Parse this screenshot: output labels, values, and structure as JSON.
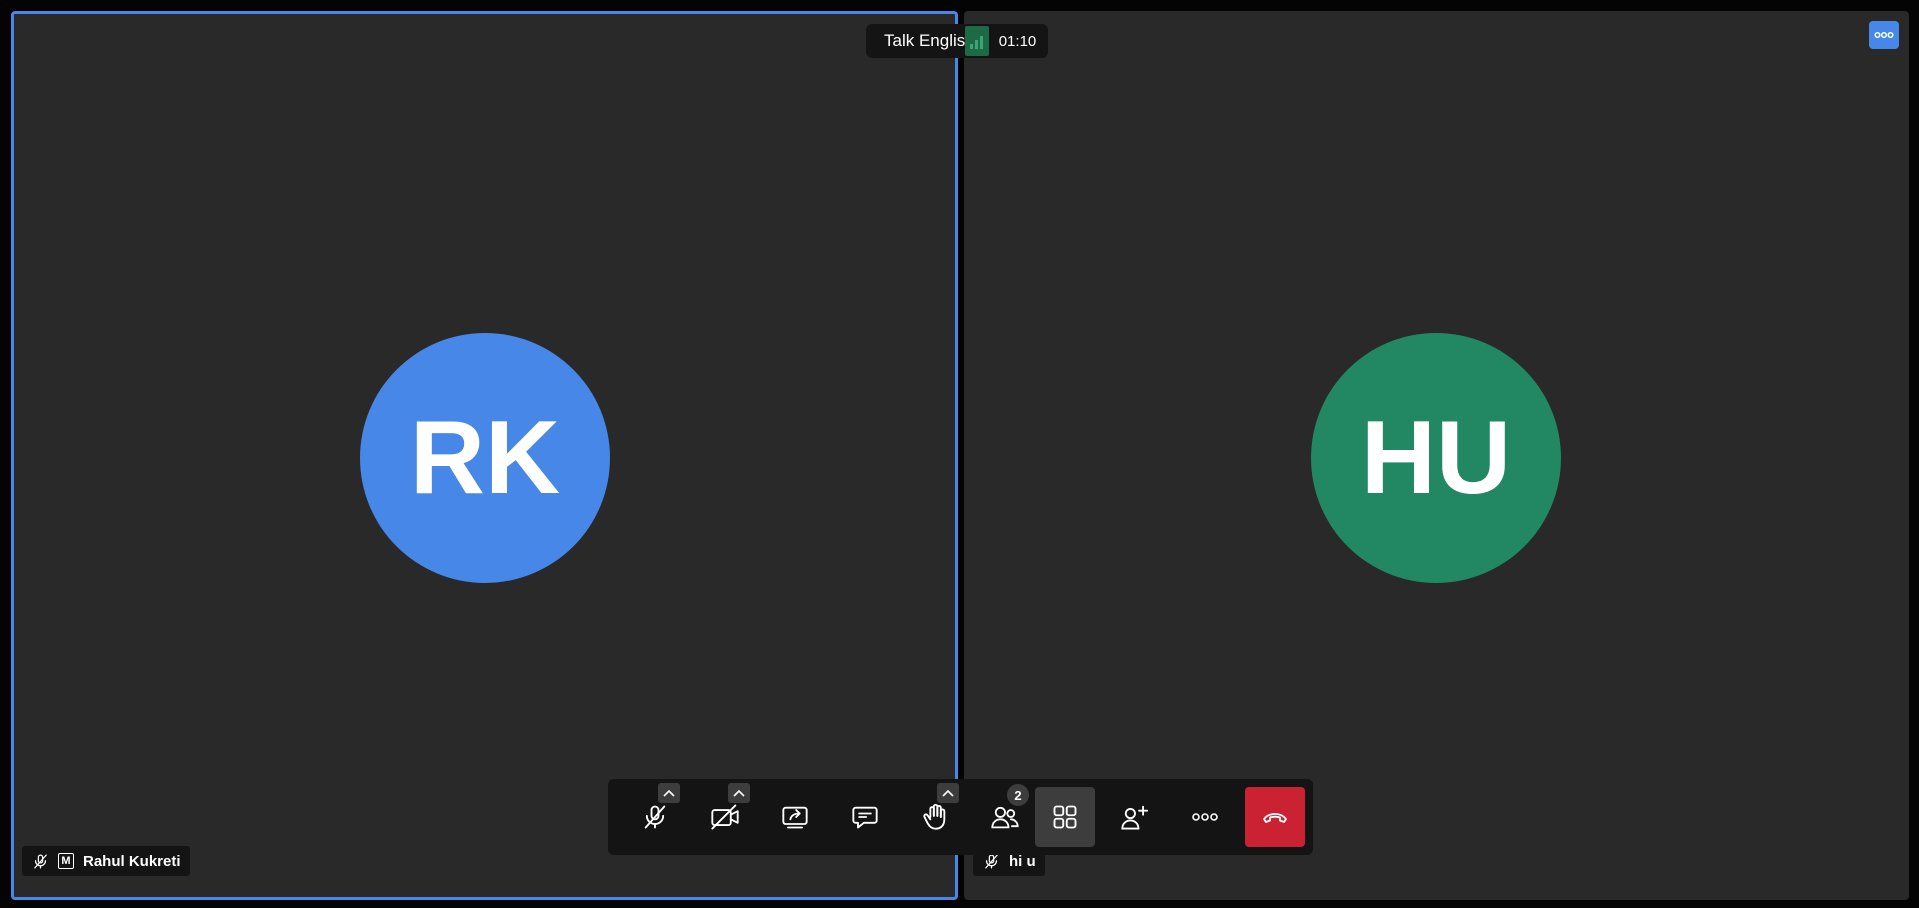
{
  "meeting": {
    "title": "Talk English",
    "timer": "01:10"
  },
  "participants": [
    {
      "initials": "RK",
      "name": "Rahul Kukreti",
      "role_badge": "M",
      "avatar_color": "#4687e8",
      "muted": true,
      "active_speaker": true
    },
    {
      "initials": "HU",
      "name": "hi u",
      "avatar_color": "#228763",
      "muted": true,
      "active_speaker": false
    }
  ],
  "toolbar": {
    "participants_count": "2",
    "hangup_color": "#cb2233",
    "buttons": [
      {
        "id": "microphone",
        "icon": "microphone-muted-icon",
        "has_menu": true
      },
      {
        "id": "camera",
        "icon": "camera-off-icon",
        "has_menu": true
      },
      {
        "id": "share-screen",
        "icon": "share-screen-icon",
        "has_menu": false
      },
      {
        "id": "chat",
        "icon": "chat-icon",
        "has_menu": false
      },
      {
        "id": "raise-hand",
        "icon": "hand-icon",
        "has_menu": true
      },
      {
        "id": "participants",
        "icon": "participants-icon",
        "has_menu": false
      },
      {
        "id": "tile-view",
        "icon": "tile-view-icon",
        "active": true
      },
      {
        "id": "invite",
        "icon": "add-person-icon",
        "has_menu": false
      },
      {
        "id": "more",
        "icon": "more-icon",
        "has_menu": false
      },
      {
        "id": "hangup",
        "icon": "hangup-icon",
        "has_menu": false
      }
    ]
  },
  "colors": {
    "accent": "#4687e8",
    "tile_bg": "#292929",
    "page_bg": "#040404"
  }
}
